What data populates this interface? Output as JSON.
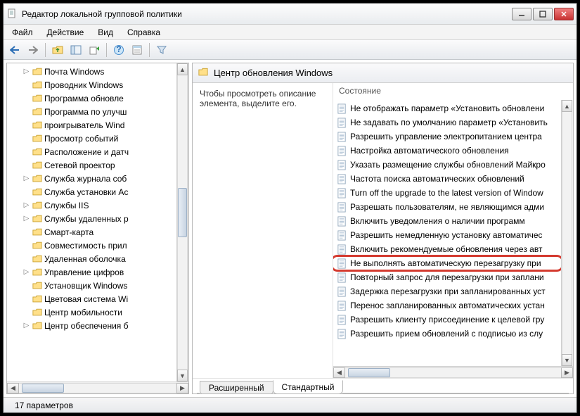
{
  "window": {
    "title": "Редактор локальной групповой политики"
  },
  "menu": {
    "file": "Файл",
    "action": "Действие",
    "view": "Вид",
    "help": "Справка"
  },
  "tree": {
    "items": [
      {
        "exp": "▷",
        "label": "Почта Windows"
      },
      {
        "exp": "",
        "label": "Проводник Windows"
      },
      {
        "exp": "",
        "label": "Программа обновле"
      },
      {
        "exp": "",
        "label": "Программа по улучш"
      },
      {
        "exp": "",
        "label": "проигрыватель Wind"
      },
      {
        "exp": "",
        "label": "Просмотр событий"
      },
      {
        "exp": "",
        "label": "Расположение и датч"
      },
      {
        "exp": "",
        "label": "Сетевой проектор"
      },
      {
        "exp": "▷",
        "label": "Служба журнала соб"
      },
      {
        "exp": "",
        "label": "Служба установки Ac"
      },
      {
        "exp": "▷",
        "label": "Службы IIS"
      },
      {
        "exp": "▷",
        "label": "Службы удаленных р"
      },
      {
        "exp": "",
        "label": "Смарт-карта"
      },
      {
        "exp": "",
        "label": "Совместимость прил"
      },
      {
        "exp": "",
        "label": "Удаленная оболочка"
      },
      {
        "exp": "▷",
        "label": "Управление цифров"
      },
      {
        "exp": "",
        "label": "Установщик Windows"
      },
      {
        "exp": "",
        "label": "Цветовая система Wi"
      },
      {
        "exp": "",
        "label": "Центр мобильности"
      },
      {
        "exp": "▷",
        "label": "Центр обеспечения б"
      }
    ]
  },
  "header": {
    "title": "Центр обновления Windows"
  },
  "desc": {
    "text": "Чтобы просмотреть описание элемента, выделите его."
  },
  "list": {
    "column": "Состояние",
    "items": [
      "Не отображать параметр «Установить обновлени",
      "Не задавать по умолчанию параметр «Установить",
      "Разрешить управление электропитанием центра",
      "Настройка автоматического обновления",
      "Указать размещение службы обновлений Майкро",
      "Частота поиска автоматических обновлений",
      "Turn off the upgrade to the latest version of Window",
      "Разрешать пользователям, не являющимся адми",
      "Включить уведомления о наличии программ",
      "Разрешить немедленную установку автоматичес",
      "Включить рекомендуемые обновления через авт",
      "Не выполнять автоматическую перезагрузку при",
      "Повторный запрос для перезагрузки при заплани",
      "Задержка перезагрузки при запланированных уст",
      "Перенос запланированных автоматических устан",
      "Разрешить клиенту присоединение к целевой гру",
      "Разрешить прием обновлений с подписью из слу"
    ],
    "highlight_index": 11
  },
  "tabs": {
    "extended": "Расширенный",
    "standard": "Стандартный"
  },
  "status": {
    "count": "17 параметров"
  }
}
